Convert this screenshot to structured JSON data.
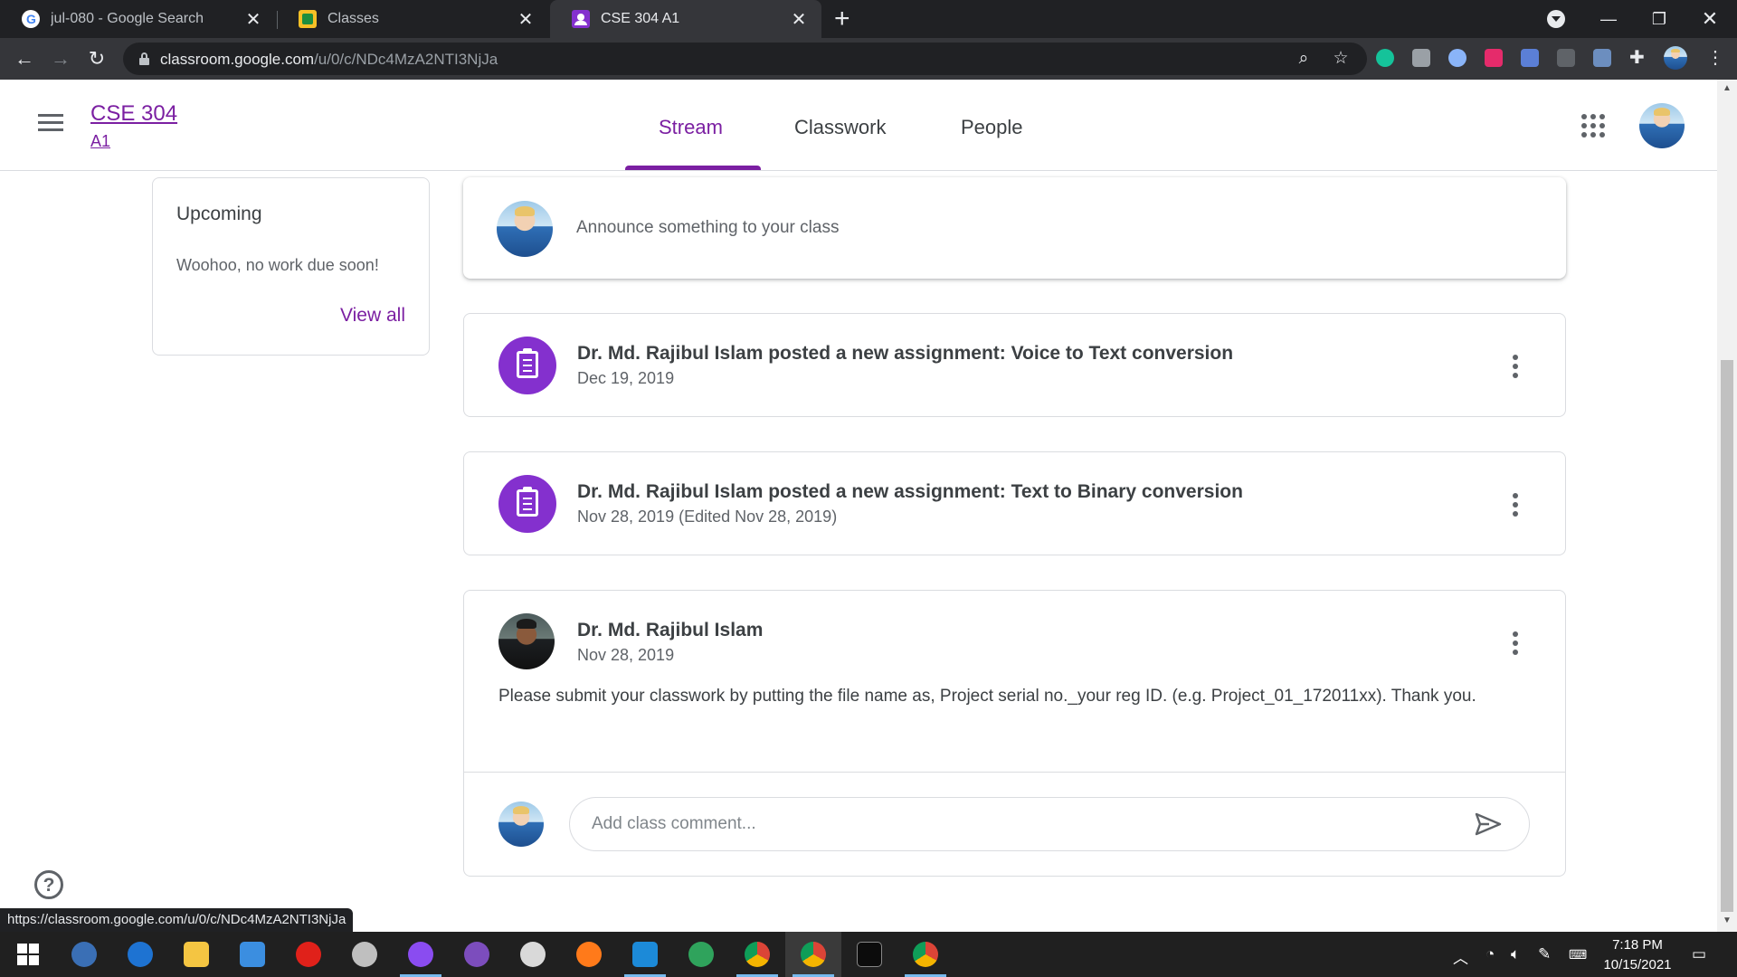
{
  "browser": {
    "tabs": [
      {
        "title": "jul-080 - Google Search",
        "favicon": "google-icon"
      },
      {
        "title": "Classes",
        "favicon": "classroom-icon"
      },
      {
        "title": "CSE 304 A1",
        "favicon": "classroom-class-icon"
      }
    ],
    "url_host": "classroom.google.com",
    "url_path": "/u/0/c/NDc4MzA2NTI3NjJa",
    "status_url": "https://classroom.google.com/u/0/c/NDc4MzA2NTI3NjJa"
  },
  "header": {
    "class_title": "CSE 304",
    "class_section": "A1",
    "tabs": [
      "Stream",
      "Classwork",
      "People"
    ],
    "active_tab": "Stream",
    "accent_color": "#7b1fa2"
  },
  "upcoming": {
    "title": "Upcoming",
    "text": "Woohoo, no work due soon!",
    "link": "View all"
  },
  "announce": {
    "placeholder": "Announce something to your class"
  },
  "posts": [
    {
      "title": "Dr. Md. Rajibul Islam posted a new assignment: Voice to Text conversion",
      "date": "Dec 19, 2019"
    },
    {
      "title": "Dr. Md. Rajibul Islam posted a new assignment: Text to Binary conversion",
      "date": "Nov 28, 2019 (Edited Nov 28, 2019)"
    },
    {
      "author": "Dr. Md. Rajibul Islam",
      "date": "Nov 28, 2019",
      "body": "Please submit your classwork by putting the file name as, Project serial no._your reg ID. (e.g. Project_01_172011xx). Thank you.",
      "comment_placeholder": "Add class comment..."
    }
  ],
  "taskbar": {
    "time": "7:18 PM",
    "date": "10/15/2021"
  }
}
